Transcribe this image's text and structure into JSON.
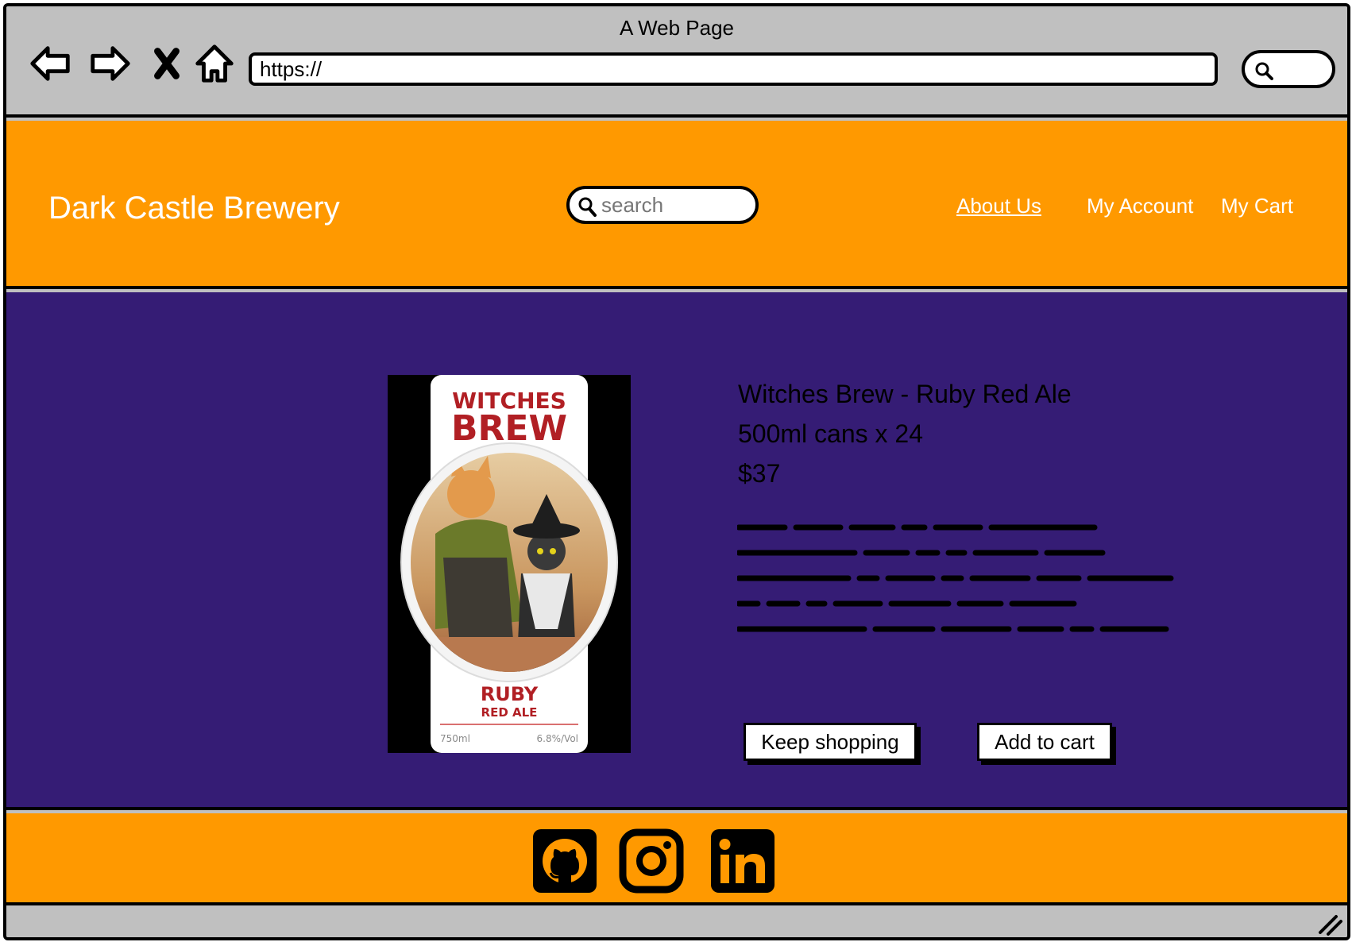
{
  "browser": {
    "title": "A Web Page",
    "url": "https://",
    "icons": [
      "back-arrow-icon",
      "forward-arrow-icon",
      "close-x-icon",
      "home-icon",
      "search-icon"
    ]
  },
  "header": {
    "brand": "Dark Castle Brewery",
    "search_placeholder": "search",
    "nav": {
      "about": "About Us",
      "account": "My Account",
      "cart": "My Cart"
    }
  },
  "product": {
    "title": "Witches Brew - Ruby Red Ale",
    "size": "500ml cans x 24",
    "price": "$37",
    "description": "",
    "label": {
      "line1": "WITCHES",
      "line2": "BREW",
      "line3": "RUBY",
      "line4": "RED ALE",
      "volume": "750ml",
      "abv": "6.8%/Vol"
    }
  },
  "actions": {
    "keep_shopping": "Keep shopping",
    "add_to_cart": "Add to cart"
  },
  "footer": {
    "social_icons": [
      "github-icon",
      "instagram-icon",
      "linkedin-icon"
    ]
  },
  "colors": {
    "header_footer": "#ff9900",
    "main_background": "#351c75",
    "chrome": "#c0c0c0",
    "label_red": "#b11f24"
  }
}
